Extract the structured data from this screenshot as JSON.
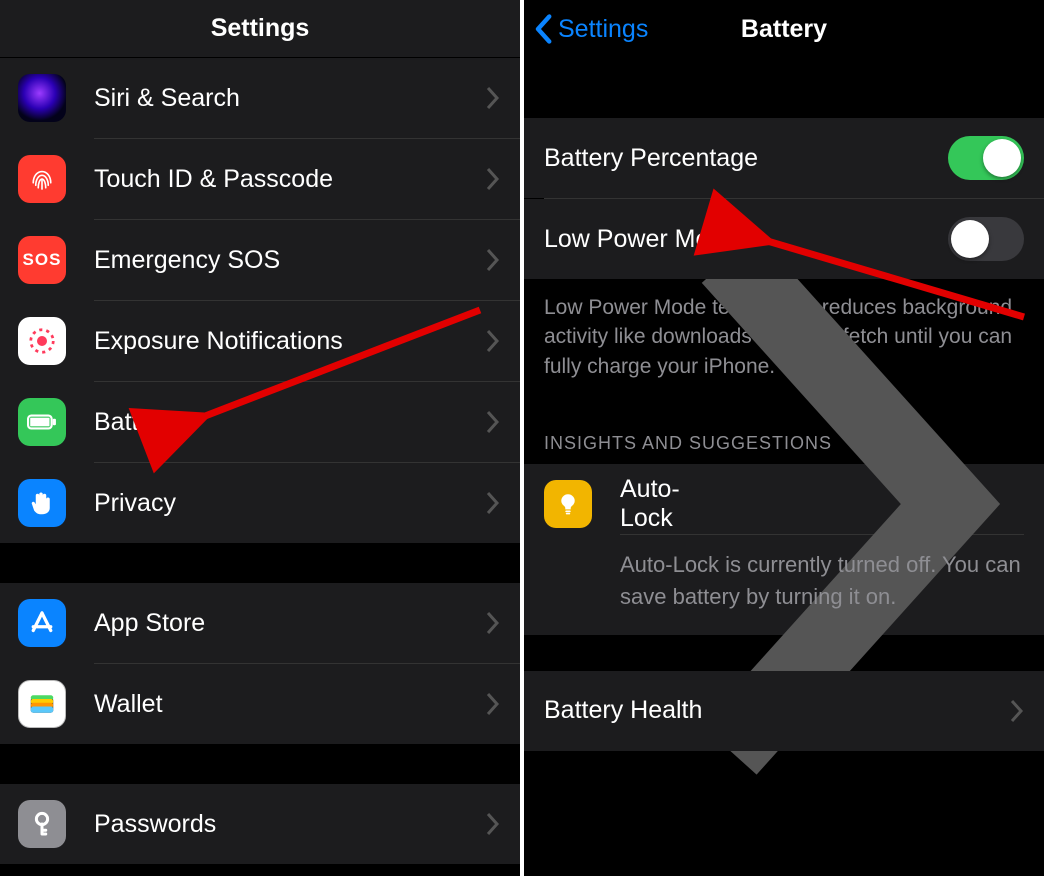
{
  "left": {
    "header": "Settings",
    "group1": [
      {
        "label": "Siri & Search"
      },
      {
        "label": "Touch ID & Passcode"
      },
      {
        "label": "Emergency SOS"
      },
      {
        "label": "Exposure Notifications"
      },
      {
        "label": "Battery"
      },
      {
        "label": "Privacy"
      }
    ],
    "group2": [
      {
        "label": "App Store"
      },
      {
        "label": "Wallet"
      }
    ],
    "group3": [
      {
        "label": "Passwords"
      }
    ],
    "sos_text": "SOS"
  },
  "right": {
    "back_label": "Settings",
    "title": "Battery",
    "switches": {
      "percentage": {
        "label": "Battery Percentage",
        "on": true
      },
      "lowpower": {
        "label": "Low Power Mode",
        "on": false
      }
    },
    "lowpower_desc": "Low Power Mode temporarily reduces background activity like downloads and mail fetch until you can fully charge your iPhone.",
    "insights_header": "INSIGHTS AND SUGGESTIONS",
    "autolock": {
      "title": "Auto-Lock",
      "desc": "Auto-Lock is currently turned off. You can save battery by turning it on."
    },
    "health_label": "Battery Health"
  }
}
